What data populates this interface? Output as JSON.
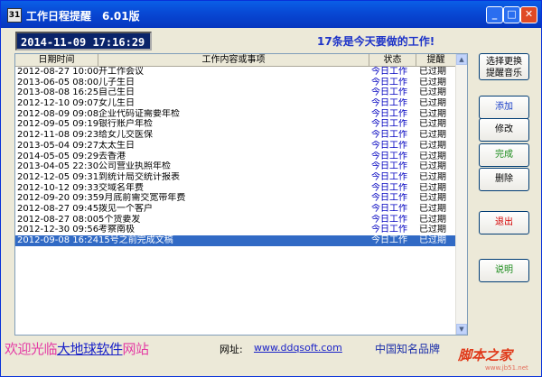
{
  "window": {
    "title": "工作日程提醒",
    "version": "6.01版",
    "app_icon": "calendar-app-icon",
    "controls": {
      "minimize": "_",
      "maximize": "□",
      "close": "✕"
    }
  },
  "datetime": "2014-11-09 17:16:29",
  "todo_banner": "17条是今天要做的工作!",
  "list": {
    "headers": [
      "日期时间",
      "工作内容或事项",
      "状态",
      "提醒"
    ],
    "rows": [
      {
        "time": "2012-08-27 10:00:00",
        "content": "开工作会议",
        "status": "今日工作",
        "remind": "已过期"
      },
      {
        "time": "2013-06-05 08:00:00",
        "content": "儿子生日",
        "status": "今日工作",
        "remind": "已过期"
      },
      {
        "time": "2013-08-08 16:25:11",
        "content": "自己生日",
        "status": "今日工作",
        "remind": "已过期"
      },
      {
        "time": "2012-12-10 09:07:39",
        "content": "女儿生日",
        "status": "今日工作",
        "remind": "已过期"
      },
      {
        "time": "2012-08-09 09:08:25",
        "content": "企业代码证需要年检",
        "status": "今日工作",
        "remind": "已过期"
      },
      {
        "time": "2012-09-05 09:19:19",
        "content": "银行账户年检",
        "status": "今日工作",
        "remind": "已过期"
      },
      {
        "time": "2012-11-08 09:23:28",
        "content": "给女儿交医保",
        "status": "今日工作",
        "remind": "已过期"
      },
      {
        "time": "2013-05-04 09:27:45",
        "content": "太太生日",
        "status": "今日工作",
        "remind": "已过期"
      },
      {
        "time": "2014-05-05 09:29:01",
        "content": "去香港",
        "status": "今日工作",
        "remind": "已过期"
      },
      {
        "time": "2013-04-05 22:30:53",
        "content": "公司营业执照年检",
        "status": "今日工作",
        "remind": "已过期"
      },
      {
        "time": "2012-12-05 09:31:48",
        "content": "到统计局交统计报表",
        "status": "今日工作",
        "remind": "已过期"
      },
      {
        "time": "2012-10-12 09:33:42",
        "content": "交域名年费",
        "status": "今日工作",
        "remind": "已过期"
      },
      {
        "time": "2012-09-20 09:35:57",
        "content": "9月底前需交宽带年费",
        "status": "今日工作",
        "remind": "已过期"
      },
      {
        "time": "2012-08-27 09:45:45",
        "content": "拨见一个客户",
        "status": "今日工作",
        "remind": "已过期"
      },
      {
        "time": "2012-08-27 08:00:29",
        "content": "5个货要发",
        "status": "今日工作",
        "remind": "已过期"
      },
      {
        "time": "2012-12-30 09:56:39",
        "content": "考察南极",
        "status": "今日工作",
        "remind": "已过期"
      },
      {
        "time": "2012-09-08 16:24:52",
        "content": "15号之前完成文稿",
        "status": "今日工作",
        "remind": "已过期",
        "selected": true
      }
    ]
  },
  "buttons": {
    "music": [
      "选择更换",
      "提醒音乐"
    ],
    "add": "添加",
    "edit": "修改",
    "done": "完成",
    "delete": "删除",
    "exit": "退出",
    "help": "说明"
  },
  "colors": {
    "title_bar": "#0848d4",
    "datetime_bg": "#0a246a",
    "banner_text": "#1d33c8",
    "status_text": "#0000c0",
    "remind_text": "#000000",
    "selected_row": "#316ac5",
    "add_text": "#1a3fc8",
    "done_text": "#1a8a1a",
    "exit_text": "#d40000",
    "help_text": "#1a8a1a",
    "welcome_text": "#e43aa4"
  },
  "footer": {
    "welcome_prefix": "欢迎光临",
    "welcome_brand": "大地球软件",
    "welcome_suffix": "网站",
    "site_label": "网址:",
    "site_url": "www.ddqsoft.com",
    "brand": "中国知名品牌",
    "watermark": "脚本之家",
    "watermark_url": "www.jb51.net"
  }
}
